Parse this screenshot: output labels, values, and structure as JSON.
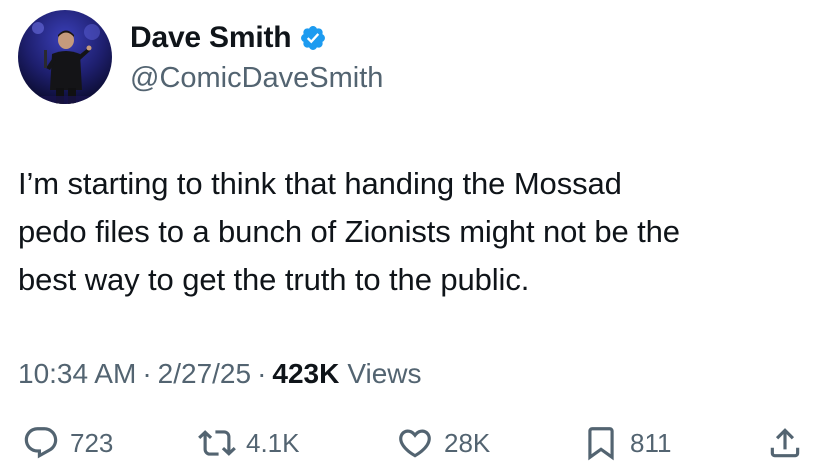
{
  "author": {
    "display_name": "Dave Smith",
    "handle": "@ComicDaveSmith",
    "verified": true,
    "verified_color": "#1d9bf0"
  },
  "tweet": {
    "text": "I’m starting to think that handing the Mossad\npedo files to a bunch of Zionists might not be the\nbest way to get the truth to the public."
  },
  "meta": {
    "time": "10:34 AM",
    "separator": "·",
    "date": "2/27/25",
    "views_count": "423K",
    "views_label": "Views"
  },
  "actions": {
    "replies": "723",
    "reposts": "4.1K",
    "likes": "28K",
    "bookmarks": "811"
  },
  "icons": {
    "reply": "reply-icon",
    "repost": "repost-icon",
    "like": "heart-icon",
    "bookmark": "bookmark-icon",
    "share": "share-icon"
  },
  "colors": {
    "text": "#0f1419",
    "secondary": "#536471",
    "accent": "#1d9bf0"
  }
}
